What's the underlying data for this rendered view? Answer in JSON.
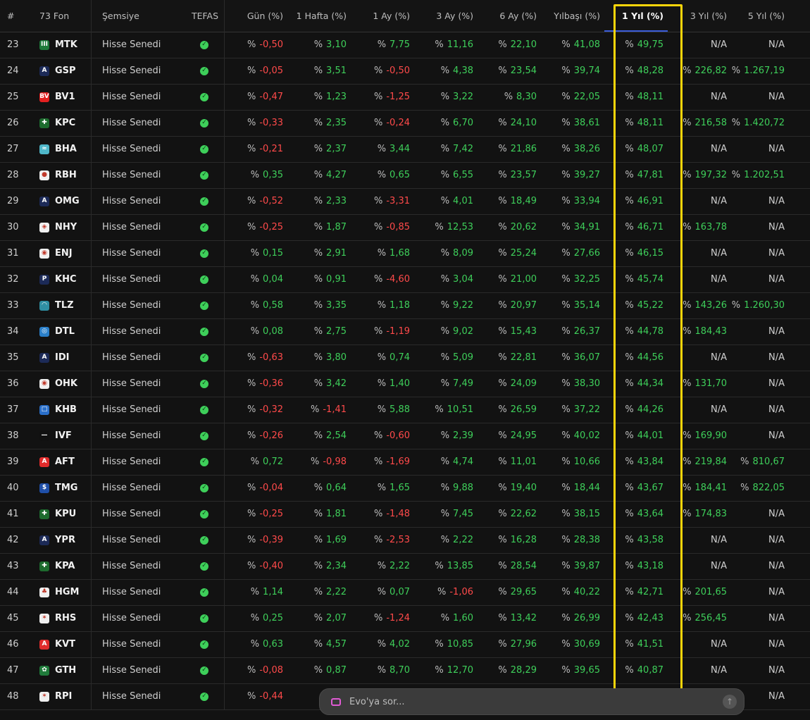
{
  "header": {
    "index": "#",
    "fund": "73 Fon",
    "umbrella": "Şemsiye",
    "tefas": "TEFAS",
    "day": "Gün (%)",
    "week1": "1 Hafta (%)",
    "month1": "1 Ay (%)",
    "month3": "3 Ay (%)",
    "month6": "6 Ay (%)",
    "ytd": "Yılbaşı (%)",
    "year1": "1 Yıl (%)",
    "year3": "3 Yıl (%)",
    "year5": "5 Yıl (%)"
  },
  "percent_sign": "%",
  "tefas_icon": "check-circle-icon",
  "rows": [
    {
      "n": "23",
      "code": "MTK",
      "logo": {
        "glyph": "III",
        "bg": "#1f7a3a"
      },
      "cat": "Hisse Senedi",
      "day": "-0,50",
      "w1": "3,10",
      "m1": "7,75",
      "m3": "11,16",
      "m6": "22,10",
      "ytd": "41,08",
      "y1": "49,75",
      "y3": "N/A",
      "y5": "N/A"
    },
    {
      "n": "24",
      "code": "GSP",
      "logo": {
        "glyph": "A",
        "bg": "#1c2a57"
      },
      "cat": "Hisse Senedi",
      "day": "-0,05",
      "w1": "3,51",
      "m1": "-0,50",
      "m3": "4,38",
      "m6": "23,54",
      "ytd": "39,74",
      "y1": "48,28",
      "y3": "226,82",
      "y5": "1.267,19"
    },
    {
      "n": "25",
      "code": "BV1",
      "logo": {
        "glyph": "BV",
        "bg": "#e32020"
      },
      "cat": "Hisse Senedi",
      "day": "-0,47",
      "w1": "1,23",
      "m1": "-1,25",
      "m3": "3,22",
      "m6": "8,30",
      "ytd": "22,05",
      "y1": "48,11",
      "y3": "N/A",
      "y5": "N/A"
    },
    {
      "n": "26",
      "code": "KPC",
      "logo": {
        "glyph": "✚",
        "bg": "#1d6b2e"
      },
      "cat": "Hisse Senedi",
      "day": "-0,33",
      "w1": "2,35",
      "m1": "-0,24",
      "m3": "6,70",
      "m6": "24,10",
      "ytd": "38,61",
      "y1": "48,11",
      "y3": "216,58",
      "y5": "1.420,72"
    },
    {
      "n": "27",
      "code": "BHA",
      "logo": {
        "glyph": "≈",
        "bg": "#4fb7c9"
      },
      "cat": "Hisse Senedi",
      "day": "-0,21",
      "w1": "2,37",
      "m1": "3,44",
      "m3": "7,42",
      "m6": "21,86",
      "ytd": "38,26",
      "y1": "48,07",
      "y3": "N/A",
      "y5": "N/A"
    },
    {
      "n": "28",
      "code": "RBH",
      "logo": {
        "glyph": "●",
        "bg": "#f0f0f0"
      },
      "cat": "Hisse Senedi",
      "day": "0,35",
      "w1": "4,27",
      "m1": "0,65",
      "m3": "6,55",
      "m6": "23,57",
      "ytd": "39,27",
      "y1": "47,81",
      "y3": "197,32",
      "y5": "1.202,51"
    },
    {
      "n": "29",
      "code": "OMG",
      "logo": {
        "glyph": "A",
        "bg": "#1c2a57"
      },
      "cat": "Hisse Senedi",
      "day": "-0,52",
      "w1": "2,33",
      "m1": "-3,31",
      "m3": "4,01",
      "m6": "18,49",
      "ytd": "33,94",
      "y1": "46,91",
      "y3": "N/A",
      "y5": "N/A"
    },
    {
      "n": "30",
      "code": "NHY",
      "logo": {
        "glyph": "◈",
        "bg": "#f0f0f0"
      },
      "cat": "Hisse Senedi",
      "day": "-0,25",
      "w1": "1,87",
      "m1": "-0,85",
      "m3": "12,53",
      "m6": "20,62",
      "ytd": "34,91",
      "y1": "46,71",
      "y3": "163,78",
      "y5": "N/A"
    },
    {
      "n": "31",
      "code": "ENJ",
      "logo": {
        "glyph": "◉",
        "bg": "#f0f0f0"
      },
      "cat": "Hisse Senedi",
      "day": "0,15",
      "w1": "2,91",
      "m1": "1,68",
      "m3": "8,09",
      "m6": "25,24",
      "ytd": "27,66",
      "y1": "46,15",
      "y3": "N/A",
      "y5": "N/A"
    },
    {
      "n": "32",
      "code": "KHC",
      "logo": {
        "glyph": "P",
        "bg": "#1c2a57"
      },
      "cat": "Hisse Senedi",
      "day": "0,04",
      "w1": "0,91",
      "m1": "-4,60",
      "m3": "3,04",
      "m6": "21,00",
      "ytd": "32,25",
      "y1": "45,74",
      "y3": "N/A",
      "y5": "N/A"
    },
    {
      "n": "33",
      "code": "TLZ",
      "logo": {
        "glyph": "◠",
        "bg": "#2f8fa3"
      },
      "cat": "Hisse Senedi",
      "day": "0,58",
      "w1": "3,35",
      "m1": "1,18",
      "m3": "9,22",
      "m6": "20,97",
      "ytd": "35,14",
      "y1": "45,22",
      "y3": "143,26",
      "y5": "1.260,30"
    },
    {
      "n": "34",
      "code": "DTL",
      "logo": {
        "glyph": "◎",
        "bg": "#2a7fc9"
      },
      "cat": "Hisse Senedi",
      "day": "0,08",
      "w1": "2,75",
      "m1": "-1,19",
      "m3": "9,02",
      "m6": "15,43",
      "ytd": "26,37",
      "y1": "44,78",
      "y3": "184,43",
      "y5": "N/A"
    },
    {
      "n": "35",
      "code": "IDI",
      "logo": {
        "glyph": "A",
        "bg": "#1c2a57"
      },
      "cat": "Hisse Senedi",
      "day": "-0,63",
      "w1": "3,80",
      "m1": "0,74",
      "m3": "5,09",
      "m6": "22,81",
      "ytd": "36,07",
      "y1": "44,56",
      "y3": "N/A",
      "y5": "N/A"
    },
    {
      "n": "36",
      "code": "OHK",
      "logo": {
        "glyph": "◉",
        "bg": "#f0f0f0"
      },
      "cat": "Hisse Senedi",
      "day": "-0,36",
      "w1": "3,42",
      "m1": "1,40",
      "m3": "7,49",
      "m6": "24,09",
      "ytd": "38,30",
      "y1": "44,34",
      "y3": "131,70",
      "y5": "N/A"
    },
    {
      "n": "37",
      "code": "KHB",
      "logo": {
        "glyph": "□",
        "bg": "#2a6fc9"
      },
      "cat": "Hisse Senedi",
      "day": "-0,32",
      "w1": "-1,41",
      "m1": "5,88",
      "m3": "10,51",
      "m6": "26,59",
      "ytd": "37,22",
      "y1": "44,26",
      "y3": "N/A",
      "y5": "N/A"
    },
    {
      "n": "38",
      "code": "IVF",
      "logo": {
        "glyph": "—",
        "bg": "#111111"
      },
      "cat": "Hisse Senedi",
      "day": "-0,26",
      "w1": "2,54",
      "m1": "-0,60",
      "m3": "2,39",
      "m6": "24,95",
      "ytd": "40,02",
      "y1": "44,01",
      "y3": "169,90",
      "y5": "N/A"
    },
    {
      "n": "39",
      "code": "AFT",
      "logo": {
        "glyph": "A",
        "bg": "#e02b2b"
      },
      "cat": "Hisse Senedi",
      "day": "0,72",
      "w1": "-0,98",
      "m1": "-1,69",
      "m3": "4,74",
      "m6": "11,01",
      "ytd": "10,66",
      "y1": "43,84",
      "y3": "219,84",
      "y5": "810,67"
    },
    {
      "n": "40",
      "code": "TMG",
      "logo": {
        "glyph": "$",
        "bg": "#1f4fa8"
      },
      "cat": "Hisse Senedi",
      "day": "-0,04",
      "w1": "0,64",
      "m1": "1,65",
      "m3": "9,88",
      "m6": "19,40",
      "ytd": "18,44",
      "y1": "43,67",
      "y3": "184,41",
      "y5": "822,05"
    },
    {
      "n": "41",
      "code": "KPU",
      "logo": {
        "glyph": "✚",
        "bg": "#1d6b2e"
      },
      "cat": "Hisse Senedi",
      "day": "-0,25",
      "w1": "1,81",
      "m1": "-1,48",
      "m3": "7,45",
      "m6": "22,62",
      "ytd": "38,15",
      "y1": "43,64",
      "y3": "174,83",
      "y5": "N/A"
    },
    {
      "n": "42",
      "code": "YPR",
      "logo": {
        "glyph": "A",
        "bg": "#1c2a57"
      },
      "cat": "Hisse Senedi",
      "day": "-0,39",
      "w1": "1,69",
      "m1": "-2,53",
      "m3": "2,22",
      "m6": "16,28",
      "ytd": "28,38",
      "y1": "43,58",
      "y3": "N/A",
      "y5": "N/A"
    },
    {
      "n": "43",
      "code": "KPA",
      "logo": {
        "glyph": "✚",
        "bg": "#1d6b2e"
      },
      "cat": "Hisse Senedi",
      "day": "-0,40",
      "w1": "2,34",
      "m1": "2,22",
      "m3": "13,85",
      "m6": "28,54",
      "ytd": "39,87",
      "y1": "43,18",
      "y3": "N/A",
      "y5": "N/A"
    },
    {
      "n": "44",
      "code": "HGM",
      "logo": {
        "glyph": "♣",
        "bg": "#f0f0f0"
      },
      "cat": "Hisse Senedi",
      "day": "1,14",
      "w1": "2,22",
      "m1": "0,07",
      "m3": "-1,06",
      "m6": "29,65",
      "ytd": "40,22",
      "y1": "42,71",
      "y3": "201,65",
      "y5": "N/A"
    },
    {
      "n": "45",
      "code": "RHS",
      "logo": {
        "glyph": "✶",
        "bg": "#f0f0f0"
      },
      "cat": "Hisse Senedi",
      "day": "0,25",
      "w1": "2,07",
      "m1": "-1,24",
      "m3": "1,60",
      "m6": "13,42",
      "ytd": "26,99",
      "y1": "42,43",
      "y3": "256,45",
      "y5": "N/A"
    },
    {
      "n": "46",
      "code": "KVT",
      "logo": {
        "glyph": "A",
        "bg": "#e02b2b"
      },
      "cat": "Hisse Senedi",
      "day": "0,63",
      "w1": "4,57",
      "m1": "4,02",
      "m3": "10,85",
      "m6": "27,96",
      "ytd": "30,69",
      "y1": "41,51",
      "y3": "N/A",
      "y5": "N/A"
    },
    {
      "n": "47",
      "code": "GTH",
      "logo": {
        "glyph": "✿",
        "bg": "#1f7a3a"
      },
      "cat": "Hisse Senedi",
      "day": "-0,08",
      "w1": "0,87",
      "m1": "8,70",
      "m3": "12,70",
      "m6": "28,29",
      "ytd": "39,65",
      "y1": "40,87",
      "y3": "N/A",
      "y5": "N/A"
    },
    {
      "n": "48",
      "code": "RPI",
      "logo": {
        "glyph": "✶",
        "bg": "#f0f0f0"
      },
      "cat": "Hisse Senedi",
      "day": "-0,44",
      "w1": "",
      "m1": "",
      "m3": "",
      "m6": "",
      "ytd": "",
      "y1": "",
      "y3": "",
      "y5": "N/A"
    }
  ],
  "chat": {
    "placeholder": "Evo'ya sor...",
    "send_icon": "arrow-up-icon",
    "bot_icon": "bot-icon"
  }
}
